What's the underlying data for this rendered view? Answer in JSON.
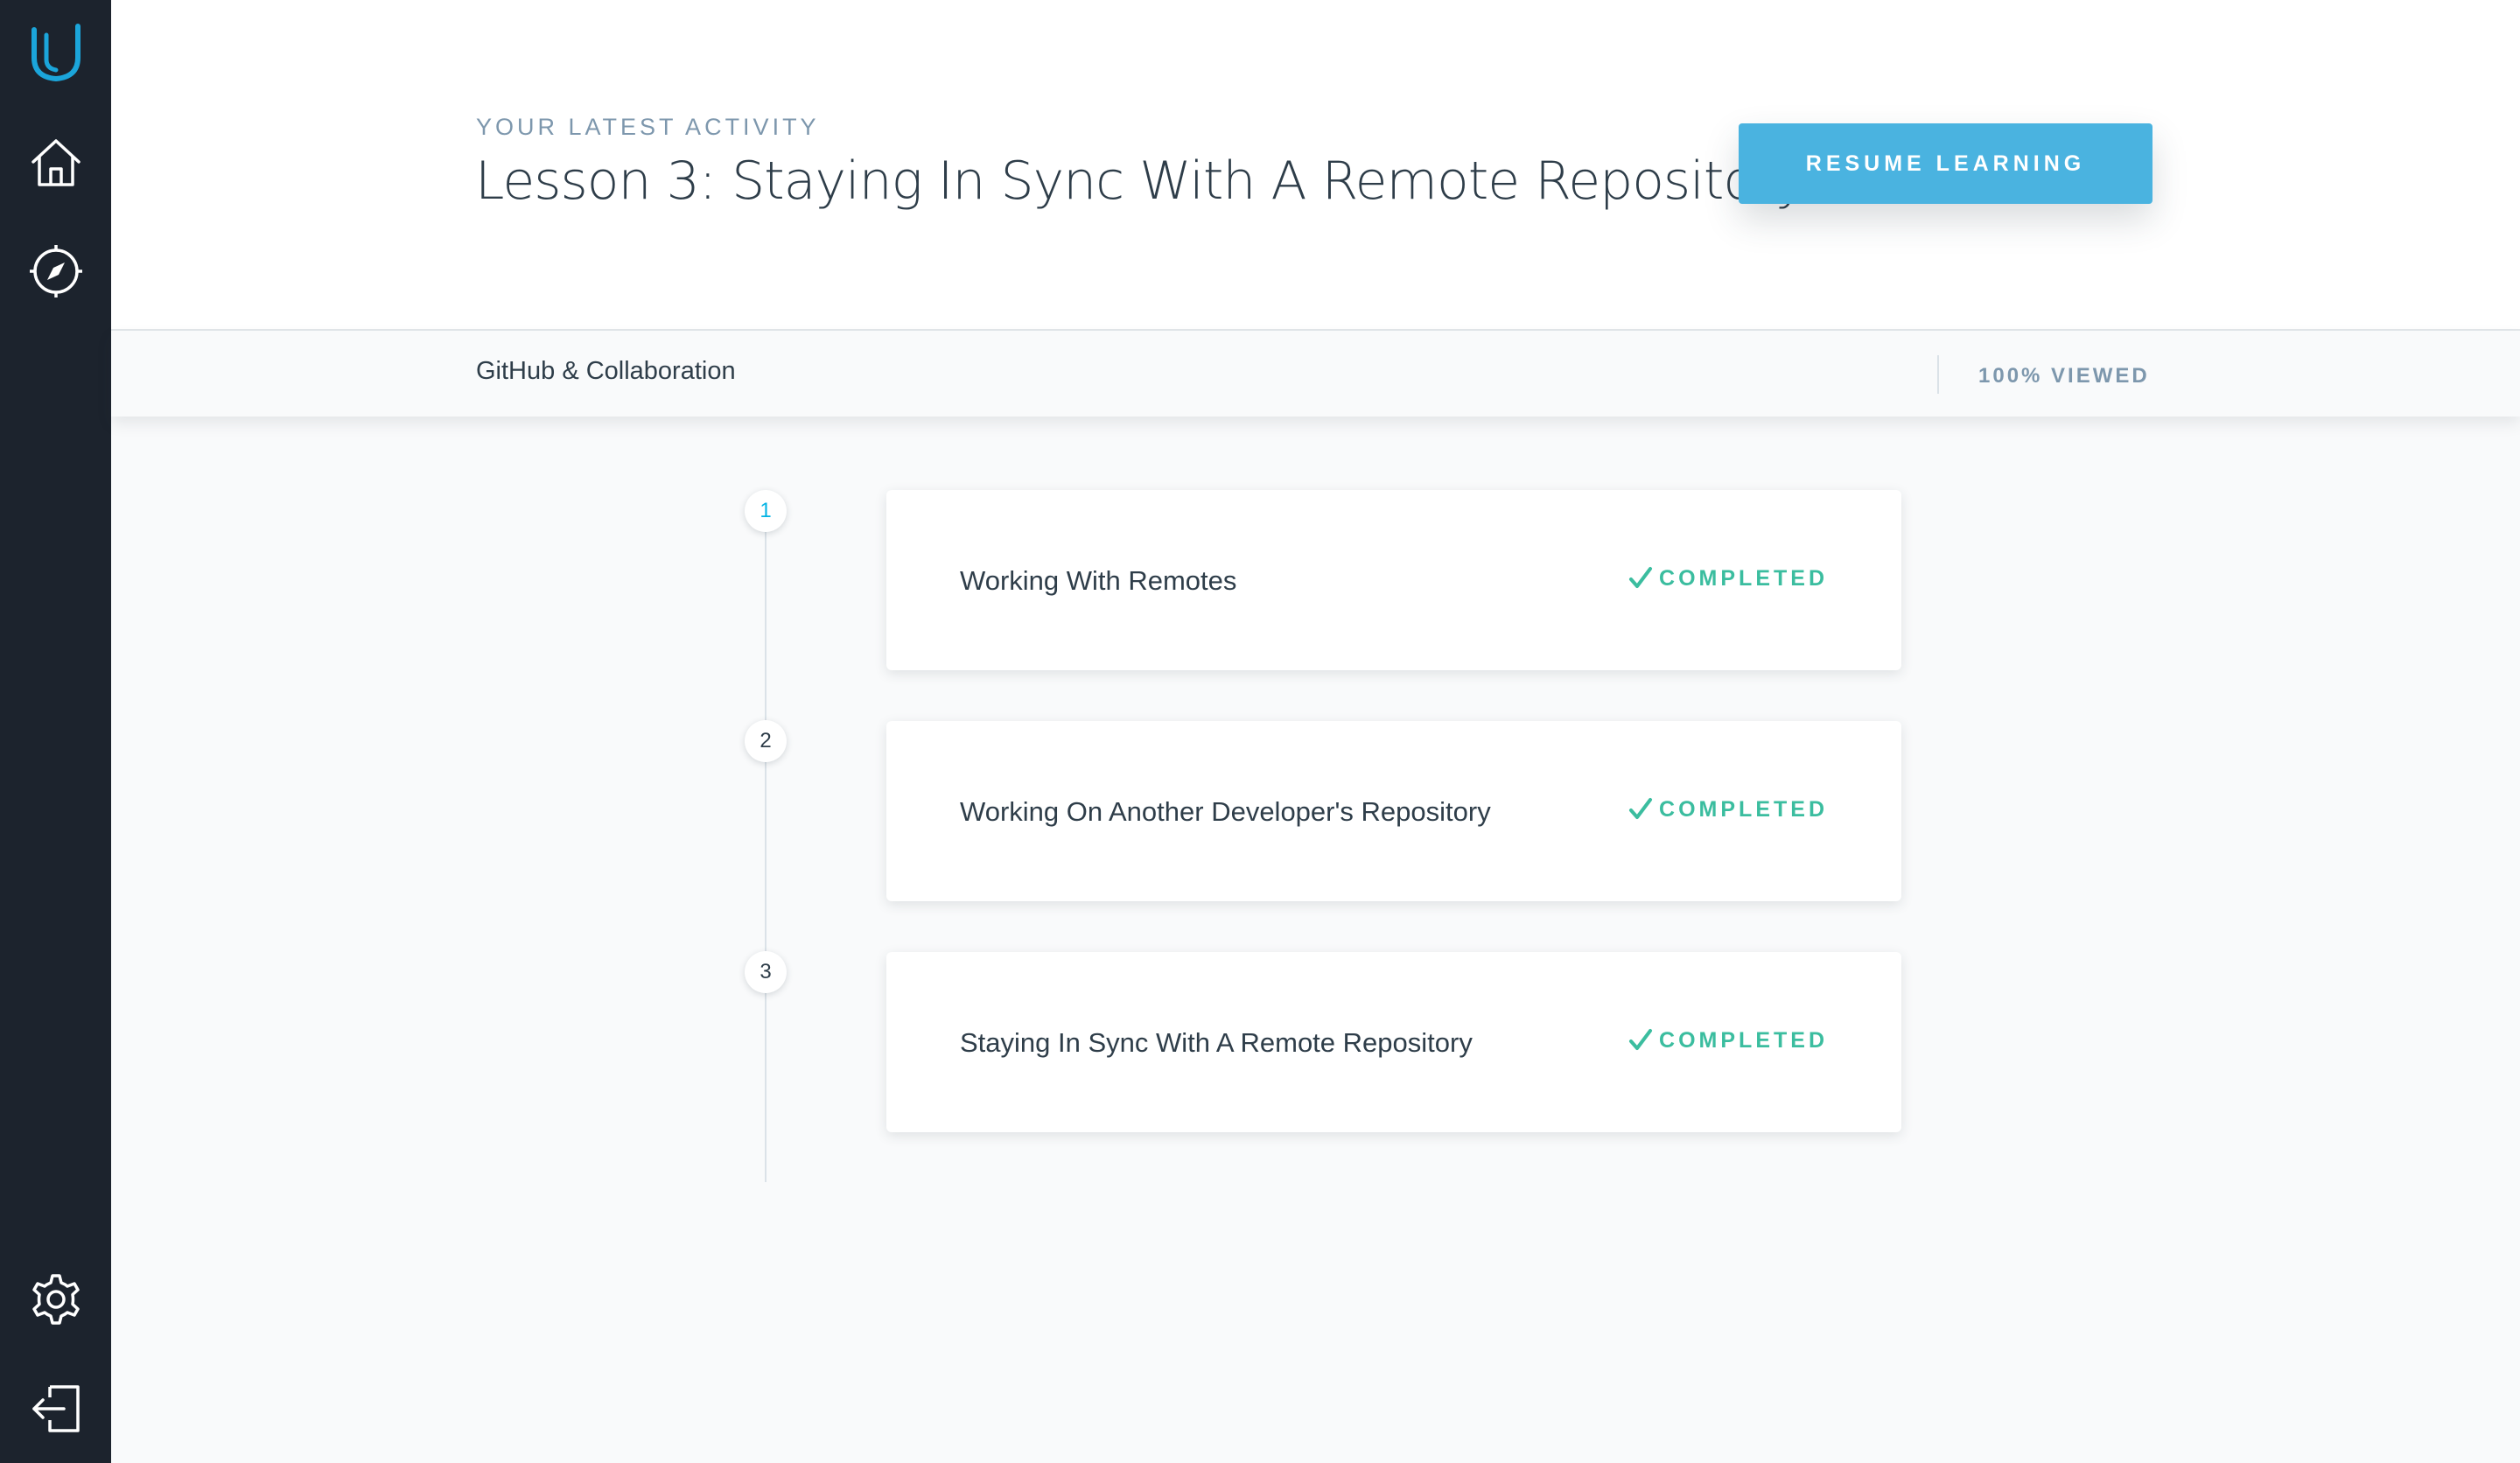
{
  "sidebar": {
    "logo": "udacity-logo-icon",
    "items": [
      {
        "icon": "home-icon"
      },
      {
        "icon": "compass-icon"
      }
    ],
    "bottom_items": [
      {
        "icon": "gear-icon"
      },
      {
        "icon": "logout-icon"
      }
    ]
  },
  "header": {
    "eyebrow": "YOUR LATEST ACTIVITY",
    "title": "Lesson 3: Staying In Sync With A Remote Repository",
    "resume_label": "RESUME LEARNING"
  },
  "subbar": {
    "course": "GitHub & Collaboration",
    "progress": "100% VIEWED"
  },
  "concepts": [
    {
      "number": "1",
      "title": "Working With Remotes",
      "status": "COMPLETED"
    },
    {
      "number": "2",
      "title": "Working On Another Developer's Repository",
      "status": "COMPLETED"
    },
    {
      "number": "3",
      "title": "Staying In Sync With A Remote Repository",
      "status": "COMPLETED"
    }
  ],
  "colors": {
    "sidebar": "#1c232d",
    "accent": "#4ab3e0",
    "completed": "#3bbd9f",
    "text": "#2e3d49",
    "muted": "#7d97ad"
  }
}
